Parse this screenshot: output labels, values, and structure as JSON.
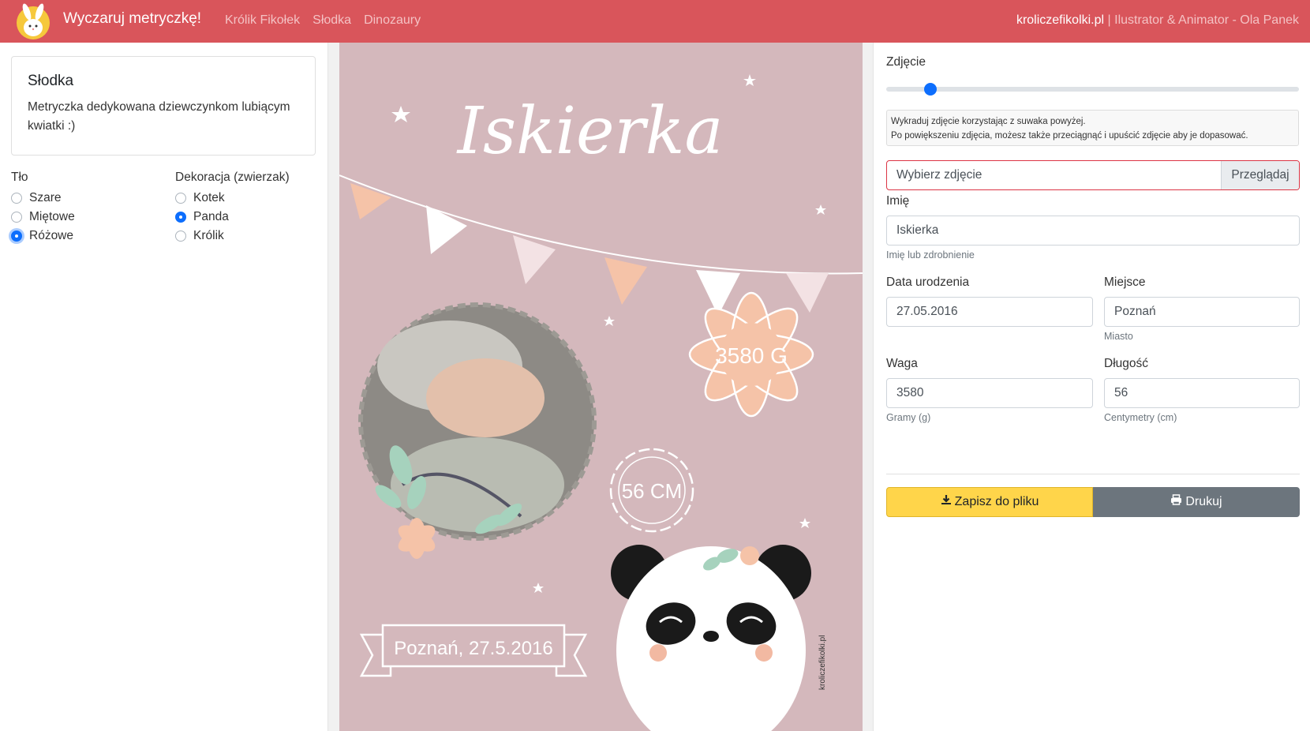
{
  "navbar": {
    "brand": "Wyczaruj metryczkę!",
    "links": [
      "Królik Fikołek",
      "Słodka",
      "Dinozaury"
    ],
    "site": "kroliczefikolki.pl",
    "separator": " | ",
    "author": "Ilustrator & Animator - Ola Panek"
  },
  "sidebar": {
    "card_title": "Słodka",
    "card_text": "Metryczka dedykowana dziewczynkom lubiącym kwiatki :)",
    "background_label": "Tło",
    "background_options": [
      {
        "label": "Szare",
        "checked": false
      },
      {
        "label": "Miętowe",
        "checked": false
      },
      {
        "label": "Różowe",
        "checked": true
      }
    ],
    "decoration_label": "Dekoracja (zwierzak)",
    "decoration_options": [
      {
        "label": "Kotek",
        "checked": false
      },
      {
        "label": "Panda",
        "checked": true
      },
      {
        "label": "Królik",
        "checked": false
      }
    ]
  },
  "poster": {
    "name": "Iskierka",
    "weight": "3580 G",
    "length": "56 CM",
    "place_date": "Poznań, 27.5.2016",
    "watermark": "kroliczefikolki.pl",
    "background_color": "#d4b8bc",
    "accent_color": "#f5c3a8"
  },
  "form": {
    "photo_label": "Zdjęcie",
    "zoom_fraction": 0.1,
    "photo_help_line1": "Wykraduj zdjęcie korzystając z suwaka powyżej.",
    "photo_help_line2": "Po powiększeniu zdjęcia, możesz także przeciągnąć i upuścić zdjęcie aby je dopasować.",
    "file_placeholder": "Wybierz zdjęcie",
    "file_button": "Przeglądaj",
    "name_label": "Imię",
    "name_value": "Iskierka",
    "name_help": "Imię lub zdrobnienie",
    "birth_label": "Data urodzenia",
    "birth_value": "27.05.2016",
    "place_label": "Miejsce",
    "place_value": "Poznań",
    "place_help": "Miasto",
    "weight_label": "Waga",
    "weight_value": "3580",
    "weight_help": "Gramy (g)",
    "length_label": "Długość",
    "length_value": "56",
    "length_help": "Centymetry (cm)",
    "save_button": "Zapisz do pliku",
    "print_button": "Drukuj"
  },
  "icons": {
    "logo": "bunny-logo-icon",
    "save": "download-icon",
    "print": "printer-icon"
  }
}
